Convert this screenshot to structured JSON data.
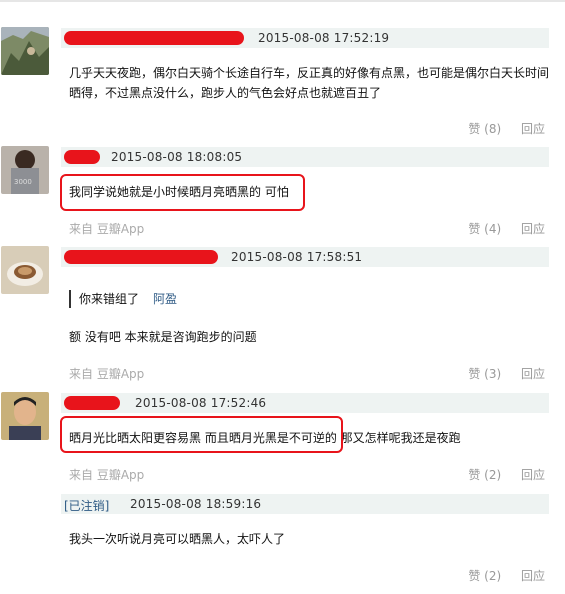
{
  "comments": [
    {
      "time": "2015-08-08 17:52:19",
      "text_line1": "几乎天天夜跑，偶尔白天骑个长途自行车，反正真的好像有点黑，也可能是偶尔白天长时间",
      "text_line2": "晒得，不过黑点没什么，跑步人的气色会好点也就遮百丑了",
      "likes": "赞 (8)",
      "reply": "回应"
    },
    {
      "time": "2015-08-08 18:08:05",
      "text": "我同学说她就是小时候晒月亮晒黑的 可怕",
      "from": "来自 豆瓣App",
      "likes": "赞 (4)",
      "reply": "回应"
    },
    {
      "time": "2015-08-08 17:58:51",
      "quote_text": "你来错组了",
      "quote_name": "阿盈",
      "text": "额 没有吧 本来就是咨询跑步的问题",
      "from": "来自 豆瓣App",
      "likes": "赞 (3)",
      "reply": "回应"
    },
    {
      "time": "2015-08-08 17:52:46",
      "text": "晒月光比晒太阳更容易黑 而且晒月光黑是不可逆的 那又怎样呢我还是夜跑",
      "from": "来自 豆瓣App",
      "likes": "赞 (2)",
      "reply": "回应"
    },
    {
      "author": "[已注销]",
      "time": "2015-08-08 18:59:16",
      "text": "我头一次听说月亮可以晒黑人，太吓人了",
      "likes": "赞 (2)",
      "reply": "回应"
    }
  ],
  "colors": {
    "annotation_red": "#e8141b",
    "header_bg": "#eef3f2",
    "link_blue": "#2f5b85",
    "muted_gray": "#999999"
  }
}
